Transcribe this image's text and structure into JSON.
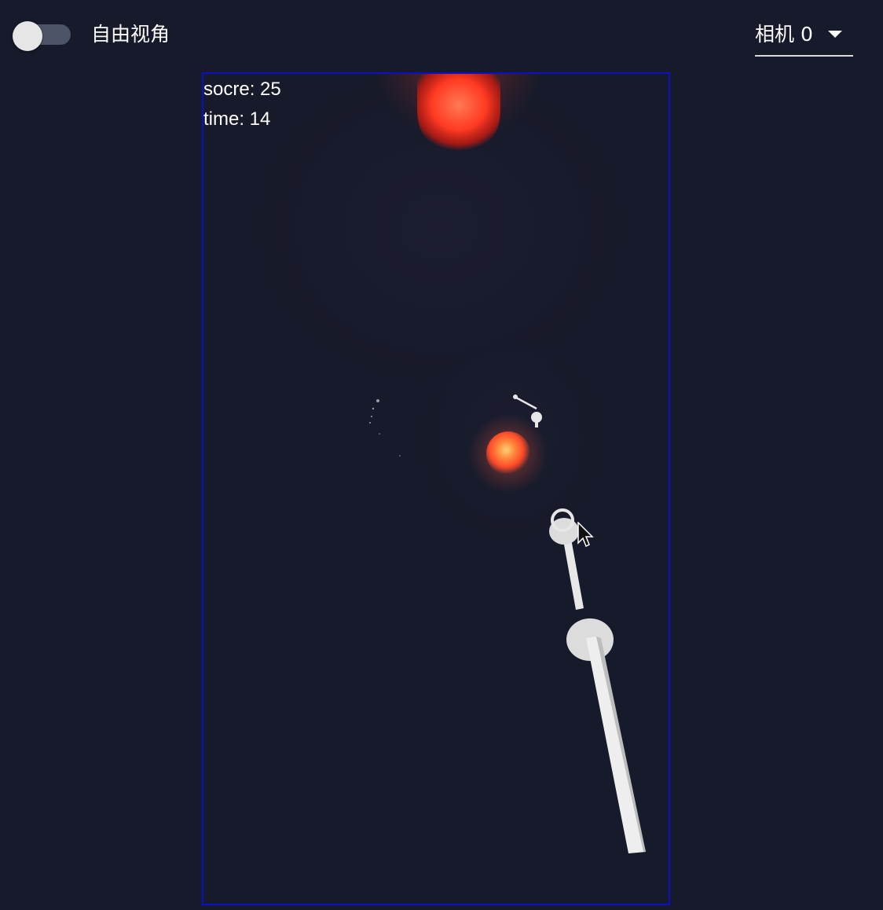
{
  "toolbar": {
    "free_view_label": "自由视角",
    "free_view_enabled": false,
    "camera_selected": "相机 0"
  },
  "game": {
    "score_text": "socre: 25",
    "time_text": "time: 14"
  },
  "colors": {
    "background": "#161a2b",
    "frame_border": "#0a10c8",
    "glow": "#ff3b2a"
  }
}
